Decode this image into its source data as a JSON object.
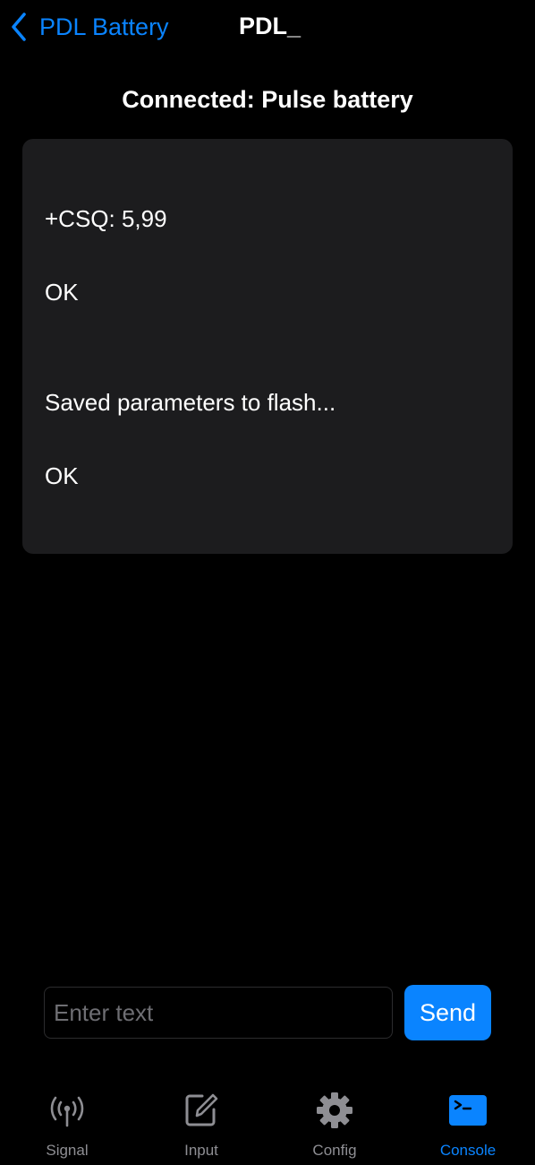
{
  "nav": {
    "back_label": "PDL Battery",
    "title": "PDL_"
  },
  "status": {
    "text": "Connected: Pulse battery"
  },
  "console": {
    "lines": [
      "+CSQ: 5,99",
      "OK",
      "Saved parameters to flash...",
      "OK"
    ]
  },
  "input": {
    "placeholder": "Enter text",
    "value": "",
    "send_label": "Send"
  },
  "tabs": [
    {
      "label": "Signal",
      "icon": "antenna-icon",
      "active": false
    },
    {
      "label": "Input",
      "icon": "compose-icon",
      "active": false
    },
    {
      "label": "Config",
      "icon": "gear-icon",
      "active": false
    },
    {
      "label": "Console",
      "icon": "terminal-icon",
      "active": true
    }
  ],
  "colors": {
    "accent": "#0a84ff",
    "background": "#000000",
    "panel": "#1c1c1e",
    "inactive": "#8e8e93"
  }
}
